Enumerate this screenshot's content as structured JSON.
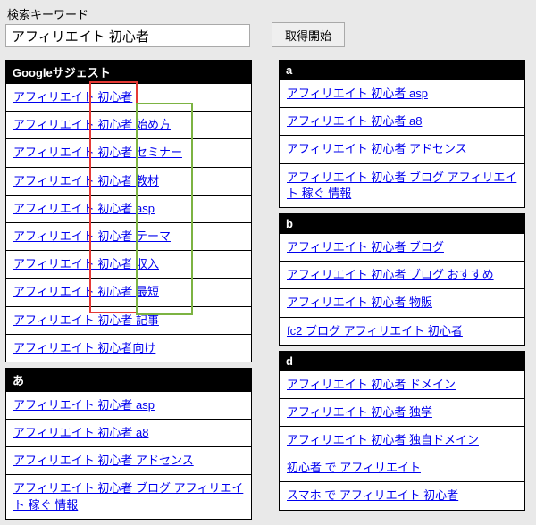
{
  "search": {
    "label": "検索キーワード",
    "value": "アフィリエイト 初心者",
    "fetch_label": "取得開始"
  },
  "left": {
    "sections": [
      {
        "header": "Googleサジェスト",
        "items": [
          "アフィリエイト 初心者",
          "アフィリエイト 初心者 始め方",
          "アフィリエイト 初心者 セミナー",
          "アフィリエイト 初心者 教材",
          "アフィリエイト 初心者 asp",
          "アフィリエイト 初心者 テーマ",
          "アフィリエイト 初心者 収入",
          "アフィリエイト 初心者 最短",
          "アフィリエイト 初心者 記事",
          "アフィリエイト 初心者向け"
        ]
      },
      {
        "header": "あ",
        "items": [
          "アフィリエイト 初心者 asp",
          "アフィリエイト 初心者 a8",
          "アフィリエイト 初心者 アドセンス",
          "アフィリエイト 初心者 ブログ アフィリエイト 稼ぐ 情報"
        ]
      }
    ]
  },
  "right": {
    "sections": [
      {
        "header": "a",
        "items": [
          "アフィリエイト 初心者 asp",
          "アフィリエイト 初心者 a8",
          "アフィリエイト 初心者 アドセンス",
          "アフィリエイト 初心者 ブログ アフィリエイト 稼ぐ 情報"
        ]
      },
      {
        "header": "b",
        "items": [
          "アフィリエイト 初心者 ブログ",
          "アフィリエイト 初心者 ブログ おすすめ",
          "アフィリエイト 初心者 物販",
          "fc2 ブログ アフィリエイト 初心者"
        ]
      },
      {
        "header": "d",
        "items": [
          "アフィリエイト 初心者 ドメイン",
          "アフィリエイト 初心者 独学",
          "アフィリエイト 初心者 独自ドメイン",
          "初心者 で アフィリエイト",
          "スマホ で アフィリエイト 初心者"
        ]
      }
    ]
  }
}
